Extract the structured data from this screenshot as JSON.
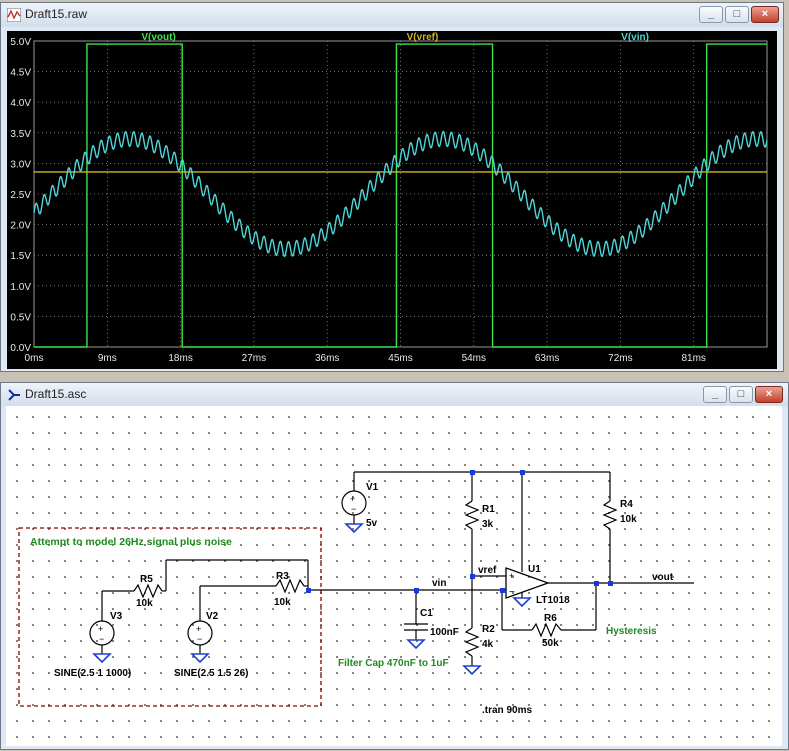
{
  "waveform_window": {
    "title": "Draft15.raw",
    "traces": [
      {
        "name": "V(vout)",
        "color": "#3ee34a"
      },
      {
        "name": "V(vref)",
        "color": "#d9b21e"
      },
      {
        "name": "V(vin)",
        "color": "#4ed6d8"
      }
    ],
    "y_ticks": [
      "5.0V",
      "4.5V",
      "4.0V",
      "3.5V",
      "3.0V",
      "2.5V",
      "2.0V",
      "1.5V",
      "1.0V",
      "0.5V",
      "0.0V"
    ],
    "x_ticks": [
      "0ms",
      "9ms",
      "18ms",
      "27ms",
      "36ms",
      "45ms",
      "54ms",
      "63ms",
      "72ms",
      "81ms"
    ]
  },
  "chart_data": {
    "type": "line",
    "title": "",
    "xlabel": "",
    "ylabel": "",
    "x_unit": "ms",
    "xlim": [
      0,
      90
    ],
    "ylim": [
      0,
      5
    ],
    "grid": true,
    "legend": "top",
    "series": [
      {
        "name": "V(vout)",
        "color": "#3ee34a",
        "kind": "step",
        "x": [
          0,
          6.5,
          6.5,
          18.2,
          18.2,
          44.5,
          44.5,
          56.3,
          56.3,
          82.6,
          82.6,
          90
        ],
        "y": [
          0,
          0,
          4.95,
          4.95,
          0,
          0,
          4.95,
          4.95,
          0,
          0,
          4.95,
          4.95
        ]
      },
      {
        "name": "V(vref)",
        "color": "#d9b21e",
        "kind": "line",
        "x": [
          0,
          90
        ],
        "y": [
          2.86,
          2.86
        ]
      },
      {
        "name": "V(vin)",
        "color": "#4ed6d8",
        "kind": "sine",
        "offset": 2.5,
        "amplitude": 0.9,
        "frequency_hz": 26,
        "phase_deg": -20,
        "noise_amplitude": 0.12,
        "noise_frequency_hz": 1000
      }
    ]
  },
  "schematic_window": {
    "title": "Draft15.asc",
    "box_label": "Attempt to model 26Hz signal plus noise",
    "labels": {
      "V1": "V1",
      "V1_val": "5v",
      "R1": "R1",
      "R1_val": "3k",
      "R2": "R2",
      "R2_val": "4k",
      "R3": "R3",
      "R3_val": "10k",
      "R4": "R4",
      "R4_val": "10k",
      "R5": "R5",
      "R5_val": "10k",
      "R6": "R6",
      "R6_val": "50k",
      "C1": "C1",
      "C1_val": "100nF",
      "U1": "U1",
      "U1_val": "LT1018",
      "V2": "V2",
      "V2_val": "SINE(2.5 1.5 26)",
      "V3": "V3",
      "V3_val": "SINE(2.5 1 1000)",
      "net_vin": "vin",
      "net_vref": "vref",
      "net_vout": "vout",
      "hysteresis": "Hysteresis",
      "cap_note": "Filter Cap 470nF to 1uF",
      "tran": ".tran 90ms"
    }
  }
}
